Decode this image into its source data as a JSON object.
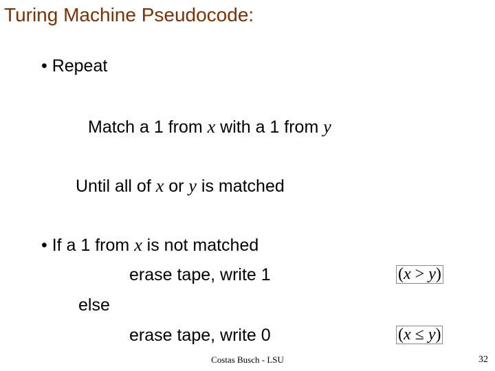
{
  "title": "Turing Machine Pseudocode:",
  "bullet_repeat": "• Repeat",
  "match": {
    "before_x": "Match a 1 from  ",
    "x": "x",
    "between": "   with a 1 from  ",
    "y": "y"
  },
  "until": {
    "before_x": "Until all  of  ",
    "x": "x",
    "or": "   or  ",
    "y": "y",
    "after": "   is matched"
  },
  "if_line": {
    "before_x": "• If a 1 from  ",
    "x": "x",
    "after": "   is not matched"
  },
  "erase1": "erase tape, write 1",
  "else_label": "else",
  "erase2": "erase tape, write 0",
  "cond1": {
    "open": "(",
    "x": "x",
    "rel": " > ",
    "y": "y",
    "close": ")"
  },
  "cond2": {
    "open": "(",
    "x": "x",
    "rel": " ≤ ",
    "y": "y",
    "close": ")"
  },
  "footer_center": "Costas Busch - LSU",
  "footer_right": "32"
}
